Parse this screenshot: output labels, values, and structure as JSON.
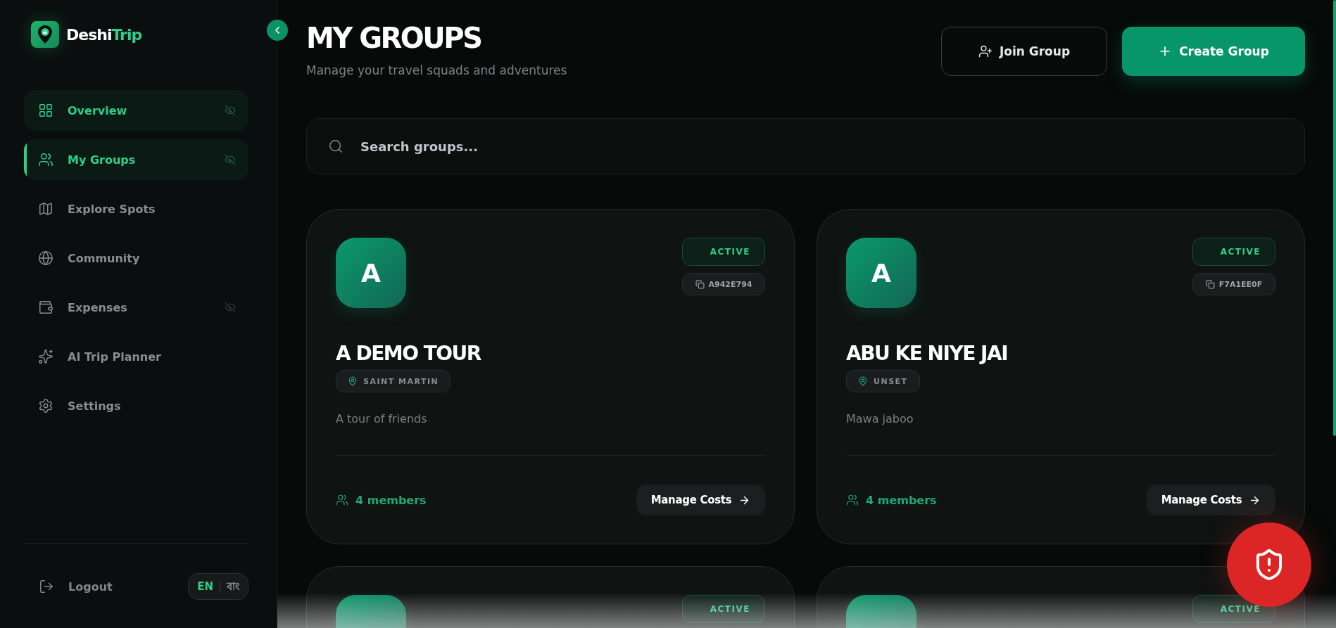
{
  "brand": {
    "name_first": "Deshi",
    "name_second": "Trip"
  },
  "sidebar": {
    "items": [
      {
        "label": "Overview",
        "selected": false,
        "highlighted": true,
        "locked": true
      },
      {
        "label": "My Groups",
        "selected": true,
        "highlighted": true,
        "locked": true
      },
      {
        "label": "Explore Spots",
        "selected": false,
        "highlighted": false,
        "locked": false
      },
      {
        "label": "Community",
        "selected": false,
        "highlighted": false,
        "locked": false
      },
      {
        "label": "Expenses",
        "selected": false,
        "highlighted": false,
        "locked": true
      },
      {
        "label": "AI Trip Planner",
        "selected": false,
        "highlighted": false,
        "locked": false
      },
      {
        "label": "Settings",
        "selected": false,
        "highlighted": false,
        "locked": false
      }
    ],
    "logout": "Logout",
    "languages": [
      {
        "label": "EN",
        "selected": true
      },
      {
        "label": "বাং",
        "selected": false
      }
    ]
  },
  "header": {
    "title": "MY GROUPS",
    "subtitle": "Manage your travel squads and adventures",
    "join_button": "Join Group",
    "create_button": "Create Group"
  },
  "search": {
    "placeholder": "Search groups..."
  },
  "groups": [
    {
      "initial": "A",
      "status": "ACTIVE",
      "code": "A942E794",
      "name": "A DEMO TOUR",
      "location": "SAINT MARTIN",
      "description": "A tour of friends",
      "members": "4 members",
      "action": "Manage Costs"
    },
    {
      "initial": "A",
      "status": "ACTIVE",
      "code": "F7A1EE0F",
      "name": "ABU KE NIYE JAI",
      "location": "UNSET",
      "description": "Mawa jaboo",
      "members": "4 members",
      "action": "Manage Costs"
    },
    {
      "status": "ACTIVE"
    },
    {
      "status": "ACTIVE"
    }
  ]
}
